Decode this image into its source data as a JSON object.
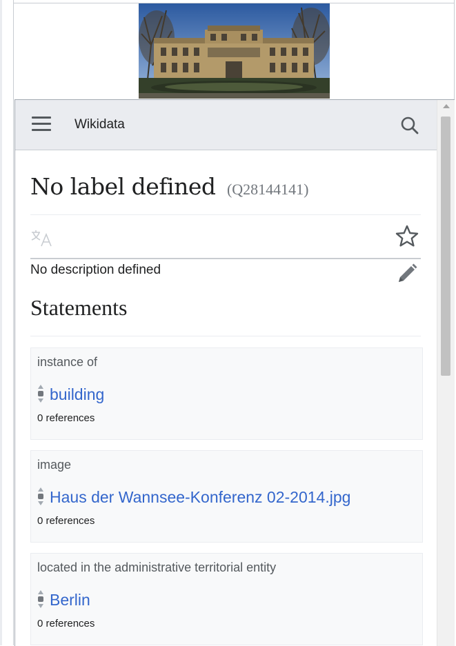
{
  "header": {
    "site_name": "Wikidata",
    "menu_icon": "hamburger-menu-icon",
    "search_icon": "search-icon"
  },
  "entity": {
    "title": "No label defined",
    "id": "(Q28144141)",
    "description": "No description defined"
  },
  "icons": {
    "translate": "translate-icon",
    "watch": "star-icon",
    "edit": "pencil-icon"
  },
  "statements": {
    "heading": "Statements",
    "items": [
      {
        "property": "instance of",
        "value": "building",
        "references": "0 references"
      },
      {
        "property": "image",
        "value": "Haus der Wannsee-Konferenz 02-2014.jpg",
        "references": "0 references"
      },
      {
        "property": "located in the administrative territorial entity",
        "value": "Berlin",
        "references": "0 references"
      }
    ]
  },
  "colors": {
    "link": "#3366cc",
    "header_bg": "#eaecf0",
    "statement_bg": "#f8f9fa"
  }
}
